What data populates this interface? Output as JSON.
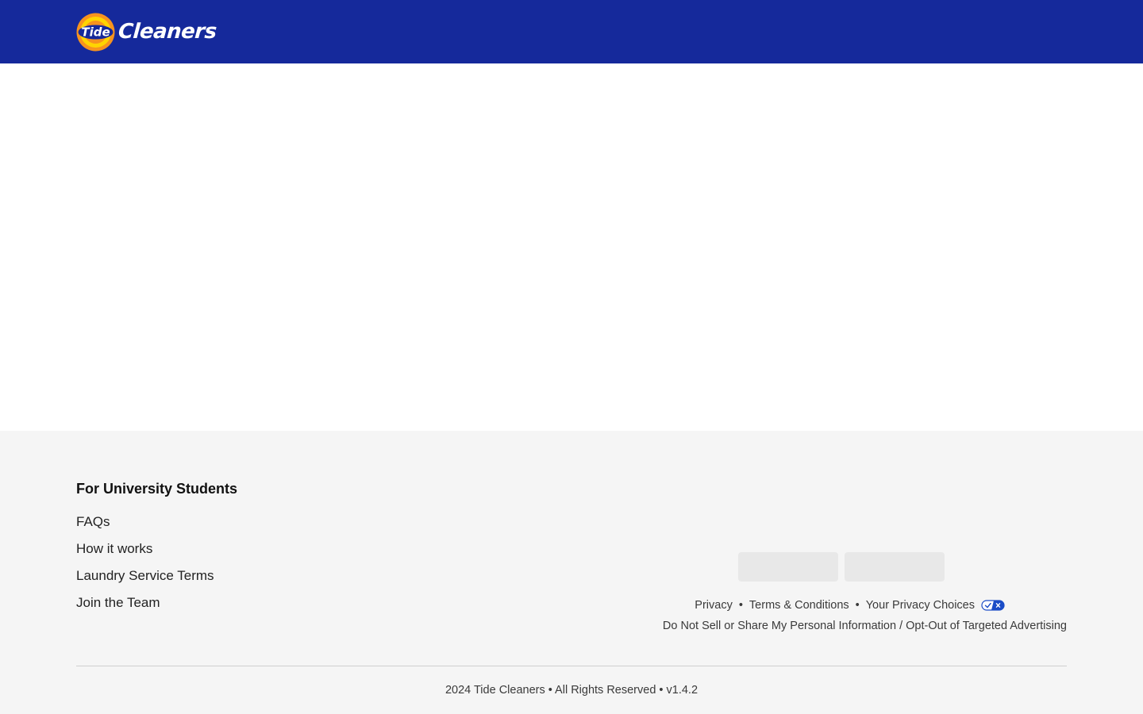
{
  "header": {
    "logo_badge_text": "Tide",
    "logo_wordmark": "Cleaners",
    "colors": {
      "background": "#15299b",
      "badge_orange": "#f7931e",
      "badge_yellow": "#ffd400",
      "badge_blue": "#15299b"
    }
  },
  "footer": {
    "section_heading": "For University Students",
    "links": [
      {
        "label": "FAQs"
      },
      {
        "label": "How it works"
      },
      {
        "label": "Laundry Service Terms"
      },
      {
        "label": "Join the Team"
      }
    ],
    "app_badges": [
      "app-store-badge",
      "google-play-badge"
    ],
    "legal": {
      "privacy": "Privacy",
      "separator": "•",
      "terms": "Terms & Conditions",
      "privacy_choices": "Your Privacy Choices",
      "privacy_choices_icon": "privacy-choices-icon",
      "optout": "Do Not Sell or Share My Personal Information / Opt-Out of Targeted Advertising"
    },
    "copyright": "2024 Tide Cleaners • All Rights Reserved • v1.4.2",
    "colors": {
      "background": "#f5f5f5",
      "divider": "#cfcfcf",
      "privacy_icon_blue": "#1a4cc7"
    }
  }
}
